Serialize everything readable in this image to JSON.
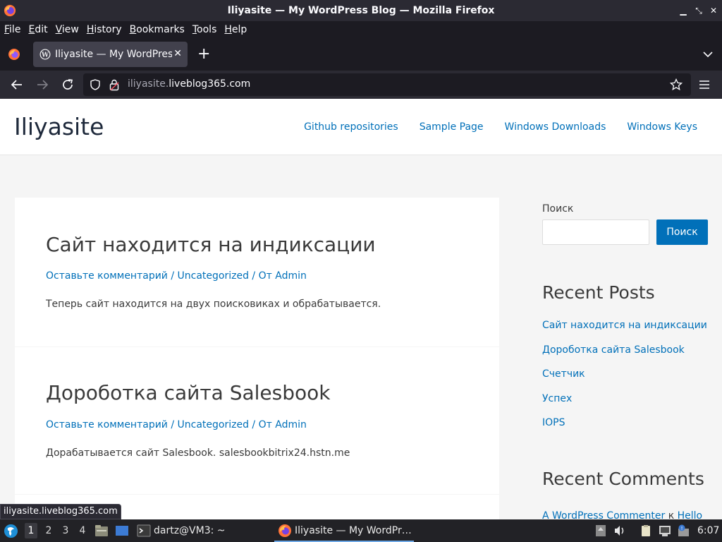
{
  "window": {
    "title": "Iliyasite — My WordPress Blog — Mozilla Firefox"
  },
  "menu": {
    "items": [
      {
        "label": "File",
        "accel": "F",
        "rest": "ile"
      },
      {
        "label": "Edit",
        "accel": "E",
        "rest": "dit"
      },
      {
        "label": "View",
        "accel": "V",
        "rest": "iew"
      },
      {
        "label": "History",
        "accel": "H",
        "rest": "istory"
      },
      {
        "label": "Bookmarks",
        "accel": "B",
        "rest": "ookmarks"
      },
      {
        "label": "Tools",
        "accel": "T",
        "rest": "ools"
      },
      {
        "label": "Help",
        "accel": "H",
        "rest": "elp"
      }
    ]
  },
  "tab": {
    "title": "Iliyasite — My WordPress Blog",
    "close": "✕"
  },
  "newtab": "+",
  "url": {
    "dim": "iliyasite.",
    "main": "liveblog365.com"
  },
  "site": {
    "title": "Iliyasite",
    "nav": [
      "Github repositories",
      "Sample Page",
      "Windows Downloads",
      "Windows Keys"
    ]
  },
  "posts": [
    {
      "title": "Сайт находится на индиксации",
      "meta": {
        "comment": "Оставьте комментарий",
        "sep": " / ",
        "category": "Uncategorized",
        "by": "От Admin"
      },
      "excerpt": "Теперь сайт находится на двух поисковиках и обрабатывается."
    },
    {
      "title": "Дороботка сайта Salesbook",
      "meta": {
        "comment": "Оставьте комментарий",
        "sep": " / ",
        "category": "Uncategorized",
        "by": "От Admin"
      },
      "excerpt": "Дорабатывается сайт Salesbook. salesbookbitrix24.hstn.me"
    }
  ],
  "sidebar": {
    "search_label": "Поиск",
    "search_button": "Поиск",
    "recent_posts_heading": "Recent Posts",
    "recent_posts": [
      "Сайт находится на индиксации",
      "Дороботка сайта Salesbook",
      "Счетчик",
      "Успех",
      "IOPS"
    ],
    "recent_comments_heading": "Recent Comments",
    "comment_author": "A WordPress Commenter",
    "comment_k": " к ",
    "comment_post": "Hello"
  },
  "status_link": "iliyasite.liveblog365.com",
  "taskbar": {
    "workspaces": [
      "1",
      "2",
      "3",
      "4"
    ],
    "terminal": "dartz@VM3: ~",
    "firefox": "Iliyasite — My WordPr…",
    "clock": "6:07"
  },
  "colors": {
    "link": "#0170b9",
    "text": "#3a3a3a",
    "chrome_dark": "#1c1b22",
    "chrome": "#2b2a33"
  }
}
